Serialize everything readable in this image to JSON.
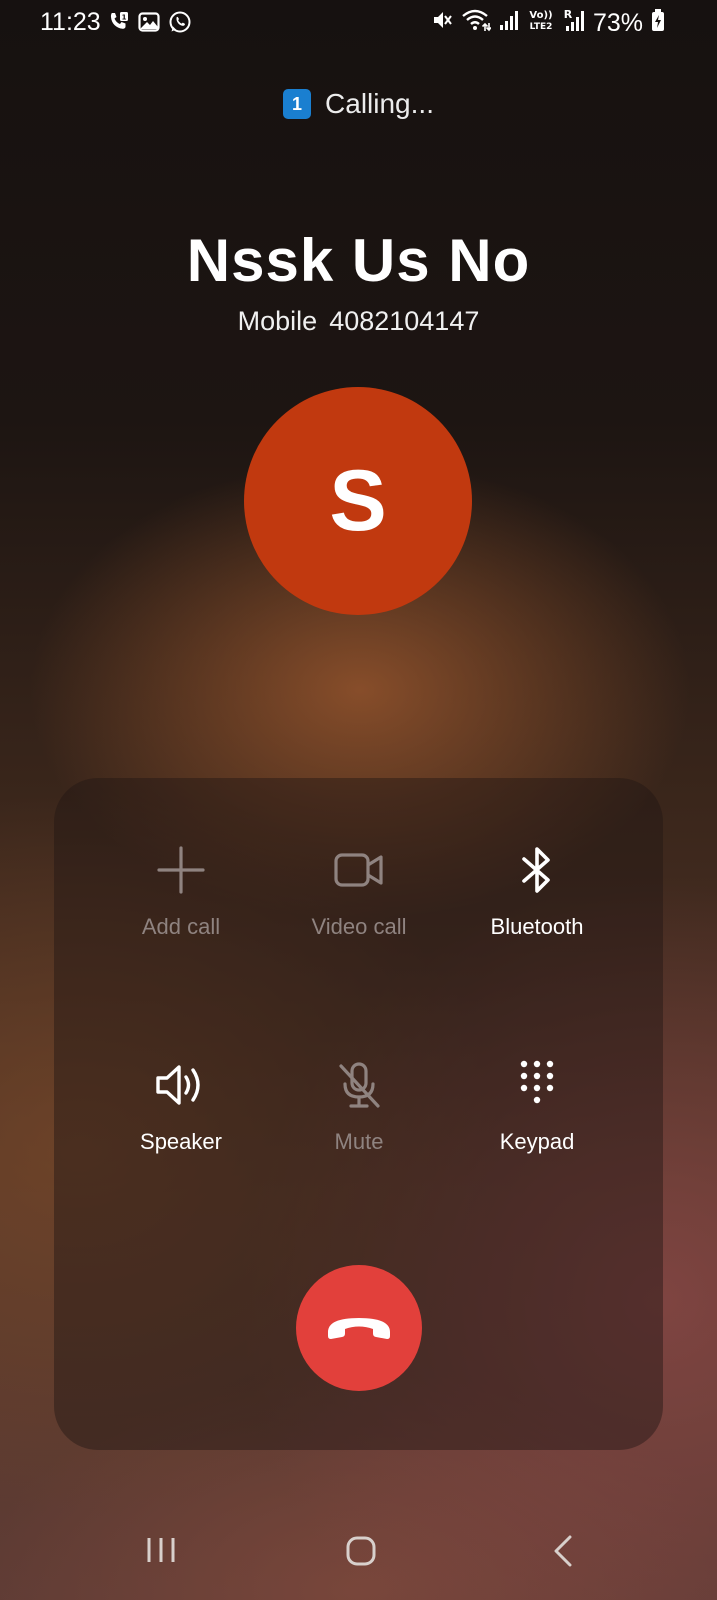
{
  "status_bar": {
    "time": "11:23",
    "battery": "73%",
    "left_icons": [
      "missed-call-icon",
      "gallery-icon",
      "whatsapp-icon"
    ],
    "right_icons": [
      "mute-icon",
      "wifi-icon",
      "signal-icon",
      "volte-icon",
      "signal-roaming-icon",
      "battery-icon"
    ],
    "volte_label": "Vo) LTE2",
    "roaming_label": "R"
  },
  "call": {
    "sim_number": "1",
    "status": "Calling...",
    "contact_name": "Nssk Us No",
    "number_type": "Mobile",
    "number": "4082104147",
    "avatar_initial": "S",
    "avatar_color": "#c1390f"
  },
  "controls": {
    "add_call": "Add call",
    "video_call": "Video call",
    "bluetooth": "Bluetooth",
    "speaker": "Speaker",
    "mute": "Mute",
    "keypad": "Keypad"
  },
  "colors": {
    "end_call": "#e2403b",
    "sim_badge": "#1a7fd0",
    "disabled_label": "#8f8380"
  },
  "nav": {
    "icons": [
      "recents-icon",
      "home-icon",
      "back-icon"
    ]
  }
}
